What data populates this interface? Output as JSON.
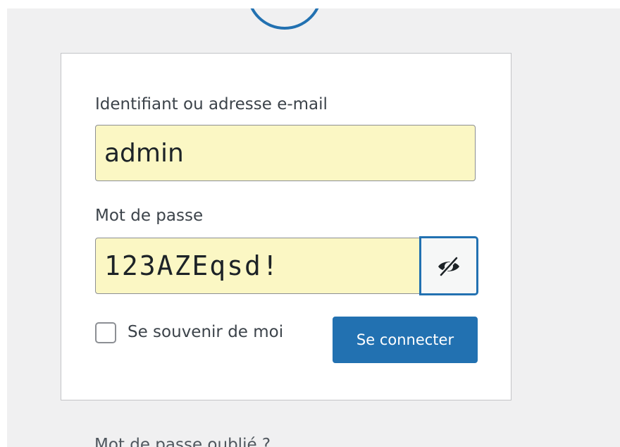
{
  "logo": {
    "icon": "wordpress-logo-icon"
  },
  "form": {
    "username": {
      "label": "Identifiant ou adresse e-mail",
      "value": "admin"
    },
    "password": {
      "label": "Mot de passe",
      "value": "123AZEqsd!",
      "toggle_icon": "eye-slash-icon"
    },
    "remember": {
      "label": "Se souvenir de moi",
      "checked": false
    },
    "submit_label": "Se connecter"
  },
  "links": {
    "lost_password": "Mot de passe oublié ?"
  },
  "colors": {
    "accent": "#2271b1",
    "autofill": "#fbf7c4",
    "page_background": "#f0f0f1"
  }
}
